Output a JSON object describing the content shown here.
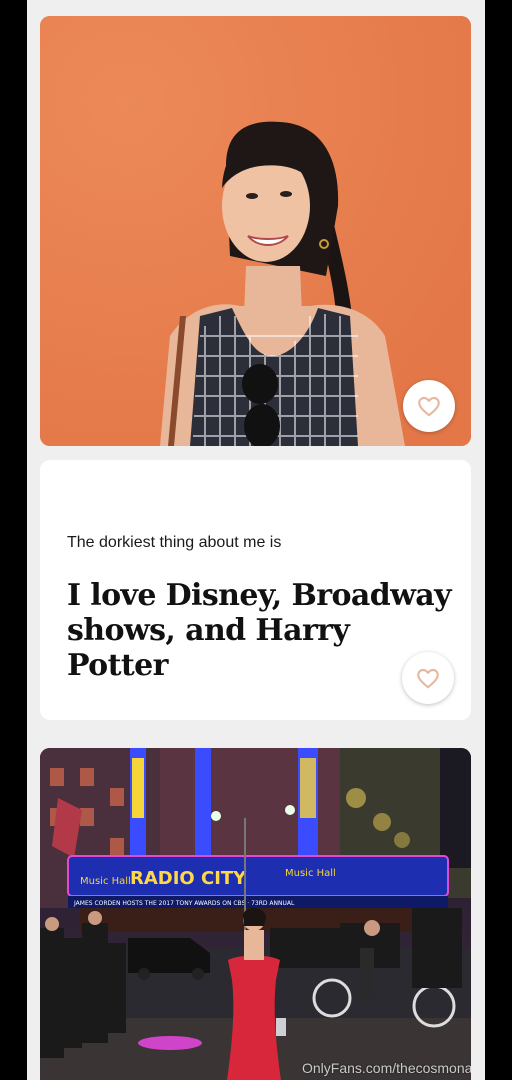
{
  "profile": {
    "prompt_question": "The dorkiest thing about me is",
    "prompt_answer": "I love Disney, Broadway shows, and Harry Potter"
  },
  "sign": {
    "main": "RADIO CITY",
    "left": "Music Hall",
    "right": "Music Hall",
    "marquee": "JAMES CORDEN HOSTS THE 2017 TONY AWARDS ON CBS · 73RD ANNUAL"
  },
  "watermark": "OnlyFans.com/thecosmonaut",
  "icons": {
    "like": "heart-outline-icon"
  },
  "colors": {
    "accent": "#e7b9a2",
    "photo_bg": "#e9804f",
    "dress": "#d8263a"
  }
}
